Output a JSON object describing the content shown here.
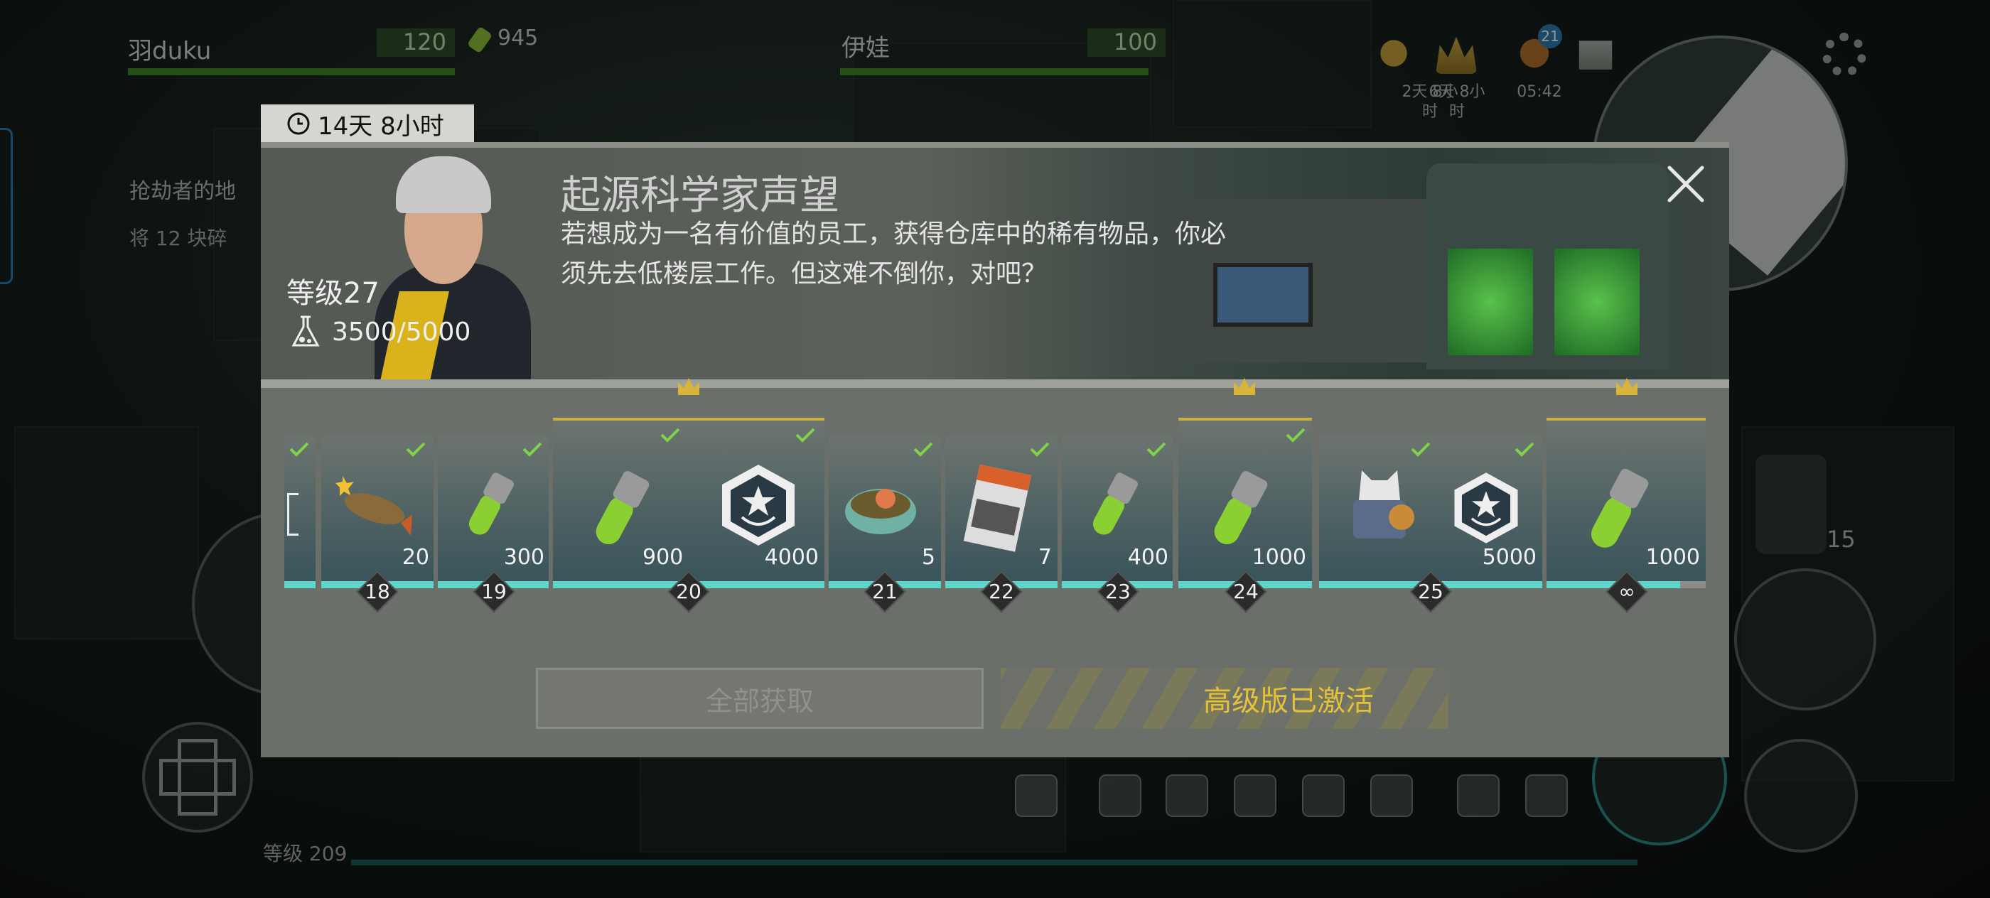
{
  "hud": {
    "player1": {
      "name": "羽duku",
      "level": "120",
      "currency": "945"
    },
    "player2": {
      "name": "伊娃",
      "level": "100"
    },
    "timer_a": "2天 8小\n时",
    "timer_b": "6天 8小\n时",
    "timer_c": "05:42",
    "notif_badge": "21",
    "quest_title": "抢劫者的地",
    "quest_sub": "将 12 块碎",
    "ammo_count": "15",
    "player_level_label": "等级 209"
  },
  "modal": {
    "timer": "14天 8小时",
    "title": "起源科学家声望",
    "description": "若想成为一名有价值的员工，获得仓库中的稀有物品，你必须先去低楼层工作。但这难不倒你，对吧？",
    "level": "等级27",
    "reputation": "3500/5000",
    "claim_all_label": "全部获取",
    "premium_label": "高级版已激活"
  },
  "rewards": [
    {
      "level": "18",
      "qty": "20",
      "item": "fish-icon",
      "premium": false,
      "claimed": true
    },
    {
      "level": "19",
      "qty": "300",
      "item": "green-vial-icon",
      "premium": false,
      "claimed": true
    },
    {
      "level": "20",
      "qty_a": "900",
      "qty_b": "4000",
      "item_a": "green-vial-icon",
      "item_b": "emblem-icon",
      "premium": true,
      "claimed": true
    },
    {
      "level": "21",
      "qty": "5",
      "item": "food-bowl-icon",
      "premium": false,
      "claimed": true
    },
    {
      "level": "22",
      "qty": "7",
      "item": "magazine-icon",
      "premium": false,
      "claimed": true
    },
    {
      "level": "23",
      "qty": "400",
      "item": "green-vial-icon",
      "premium": false,
      "claimed": true
    },
    {
      "level": "24",
      "qty": "1000",
      "item": "green-vial-icon",
      "premium": true,
      "claimed": true
    },
    {
      "level": "25",
      "qty_b": "5000",
      "item_a": "armor-icon",
      "item_b": "emblem-icon",
      "premium": false,
      "claimed": true
    },
    {
      "level": "∞",
      "qty": "1000",
      "item": "green-vial-icon",
      "premium": true,
      "claimed": false
    }
  ],
  "colors": {
    "accent_teal": "#5fd6c9",
    "check_green": "#7fd34a",
    "premium_gold": "#e5c13a"
  }
}
